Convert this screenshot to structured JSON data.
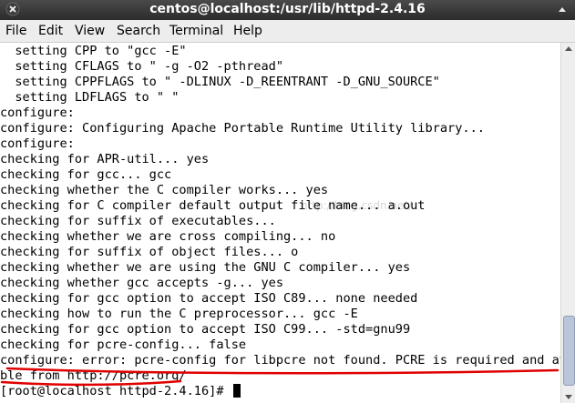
{
  "window": {
    "title": "centos@localhost:/usr/lib/httpd-2.4.16"
  },
  "menu": [
    "File",
    "Edit",
    "View",
    "Search",
    "Terminal",
    "Help"
  ],
  "terminal": {
    "lines": [
      "  setting CPP to \"gcc -E\"",
      "  setting CFLAGS to \" -g -O2 -pthread\"",
      "  setting CPPFLAGS to \" -DLINUX -D_REENTRANT -D_GNU_SOURCE\"",
      "  setting LDFLAGS to \" \"",
      "configure:",
      "configure: Configuring Apache Portable Runtime Utility library...",
      "configure:",
      "checking for APR-util... yes",
      "checking for gcc... gcc",
      "checking whether the C compiler works... yes",
      "checking for C compiler default output file name... a.out",
      "checking for suffix of executables...",
      "checking whether we are cross compiling... no",
      "checking for suffix of object files... o",
      "checking whether we are using the GNU C compiler... yes",
      "checking whether gcc accepts -g... yes",
      "checking for gcc option to accept ISO C89... none needed",
      "checking how to run the C preprocessor... gcc -E",
      "checking for gcc option to accept ISO C99... -std=gnu99",
      "checking for pcre-config... false",
      "configure: error: pcre-config for libpcre not found. PCRE is required and ava",
      "ble from http://pcre.org/",
      "[root@localhost httpd-2.4.16]# "
    ]
  },
  "watermark": "http://blog.csdn.net/",
  "colors": {
    "annotation": "#e00000"
  }
}
